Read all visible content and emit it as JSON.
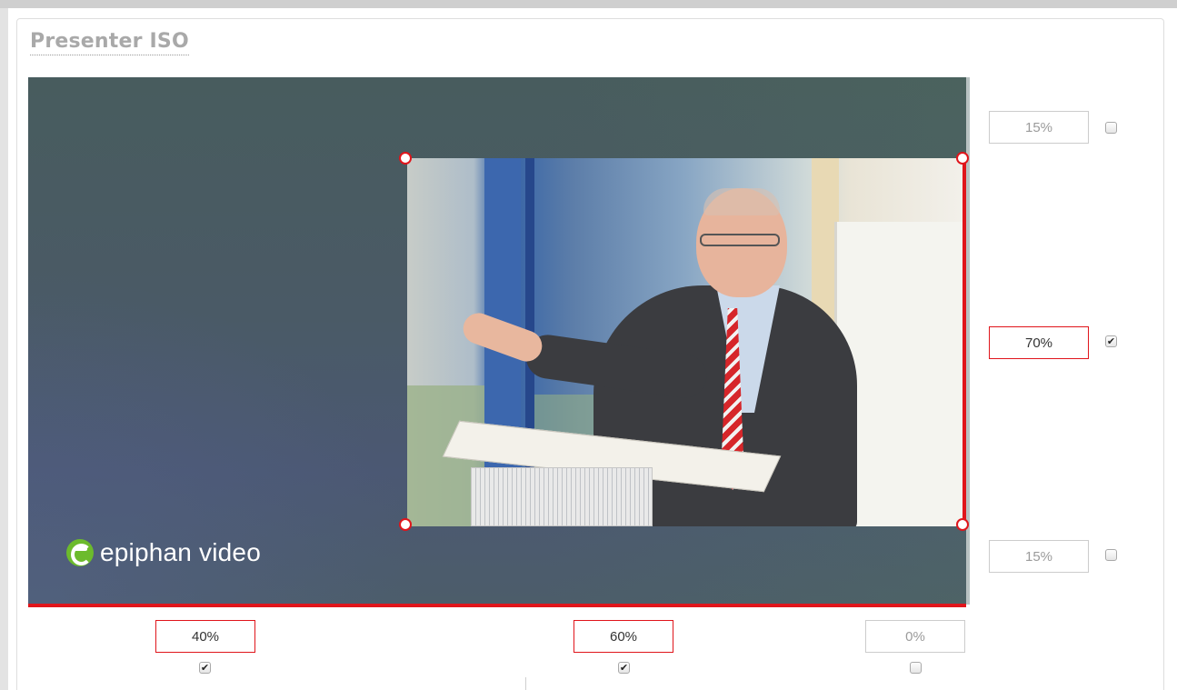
{
  "panel": {
    "title": "Presenter ISO"
  },
  "brand": {
    "text": "epiphan video",
    "logo_color": "#6cbb2c"
  },
  "colors": {
    "accent": "#e0151b",
    "title_gray": "#a9a9a9"
  },
  "right_controls": [
    {
      "value": "15%",
      "checked": false,
      "active": false
    },
    {
      "value": "70%",
      "checked": true,
      "active": true
    },
    {
      "value": "15%",
      "checked": false,
      "active": false
    }
  ],
  "bottom_controls": [
    {
      "value": "40%",
      "checked": true,
      "active": true
    },
    {
      "value": "60%",
      "checked": true,
      "active": true
    },
    {
      "value": "0%",
      "checked": false,
      "active": false
    }
  ],
  "checkmark": "✔"
}
